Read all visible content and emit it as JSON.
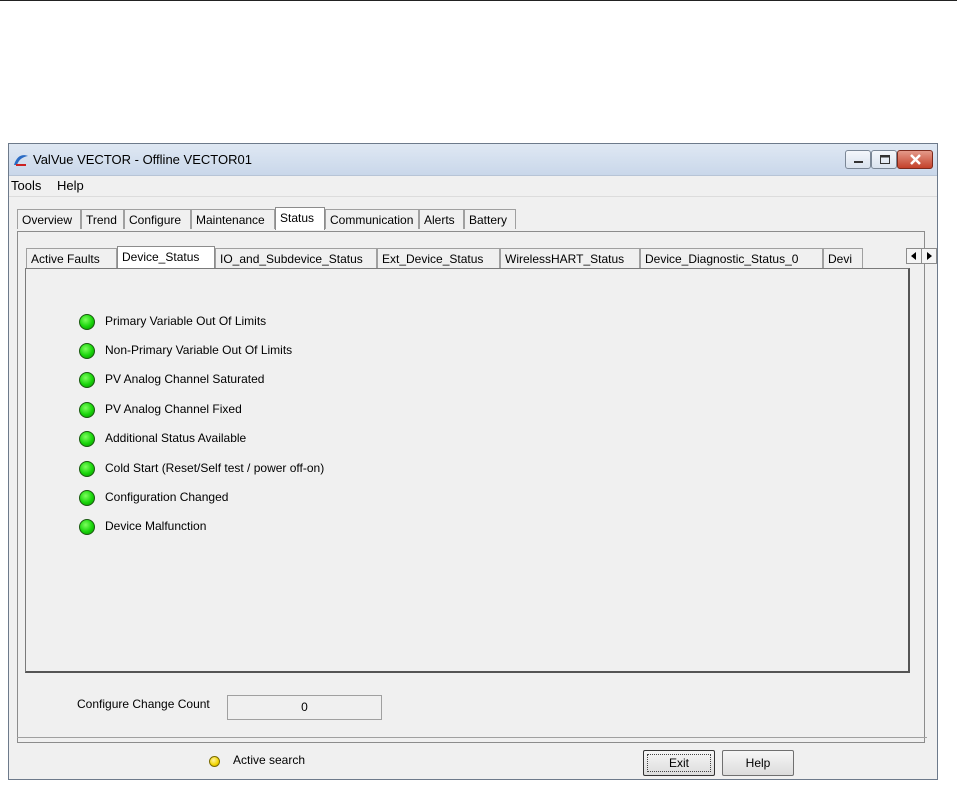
{
  "window": {
    "title": "ValVue VECTOR - Offline  VECTOR01",
    "controls": [
      "minimize-icon",
      "maximize-icon",
      "close-icon"
    ]
  },
  "menu": [
    "Tools",
    "Help"
  ],
  "outer_tabs": [
    {
      "label": "Overview",
      "active": false
    },
    {
      "label": "Trend",
      "active": false
    },
    {
      "label": "Configure",
      "active": false
    },
    {
      "label": "Maintenance",
      "active": false
    },
    {
      "label": "Status",
      "active": true
    },
    {
      "label": "Communication",
      "active": false
    },
    {
      "label": "Alerts",
      "active": false
    },
    {
      "label": "Battery",
      "active": false
    }
  ],
  "inner_tabs": [
    {
      "label": "Active Faults",
      "active": false
    },
    {
      "label": "Device_Status",
      "active": true
    },
    {
      "label": "IO_and_Subdevice_Status",
      "active": false
    },
    {
      "label": "Ext_Device_Status",
      "active": false
    },
    {
      "label": "WirelessHART_Status",
      "active": false
    },
    {
      "label": "Device_Diagnostic_Status_0",
      "active": false
    },
    {
      "label": "Devi",
      "active": false
    }
  ],
  "status_items": [
    {
      "label": "Primary Variable Out Of Limits",
      "state": "ok"
    },
    {
      "label": "Non-Primary Variable Out Of Limits",
      "state": "ok"
    },
    {
      "label": "PV Analog Channel Saturated",
      "state": "ok"
    },
    {
      "label": "PV Analog Channel Fixed",
      "state": "ok"
    },
    {
      "label": "Additional Status Available",
      "state": "ok"
    },
    {
      "label": "Cold Start (Reset/Self test / power off-on)",
      "state": "ok"
    },
    {
      "label": "Configuration Changed",
      "state": "ok"
    },
    {
      "label": "Device Malfunction",
      "state": "ok"
    }
  ],
  "config_change": {
    "label": "Configure Change Count",
    "value": "0"
  },
  "footer": {
    "search_label": "Active search",
    "exit_label": "Exit",
    "help_label": "Help"
  },
  "colors": {
    "led_ok": "#18d40a",
    "led_search": "#f2d500"
  }
}
